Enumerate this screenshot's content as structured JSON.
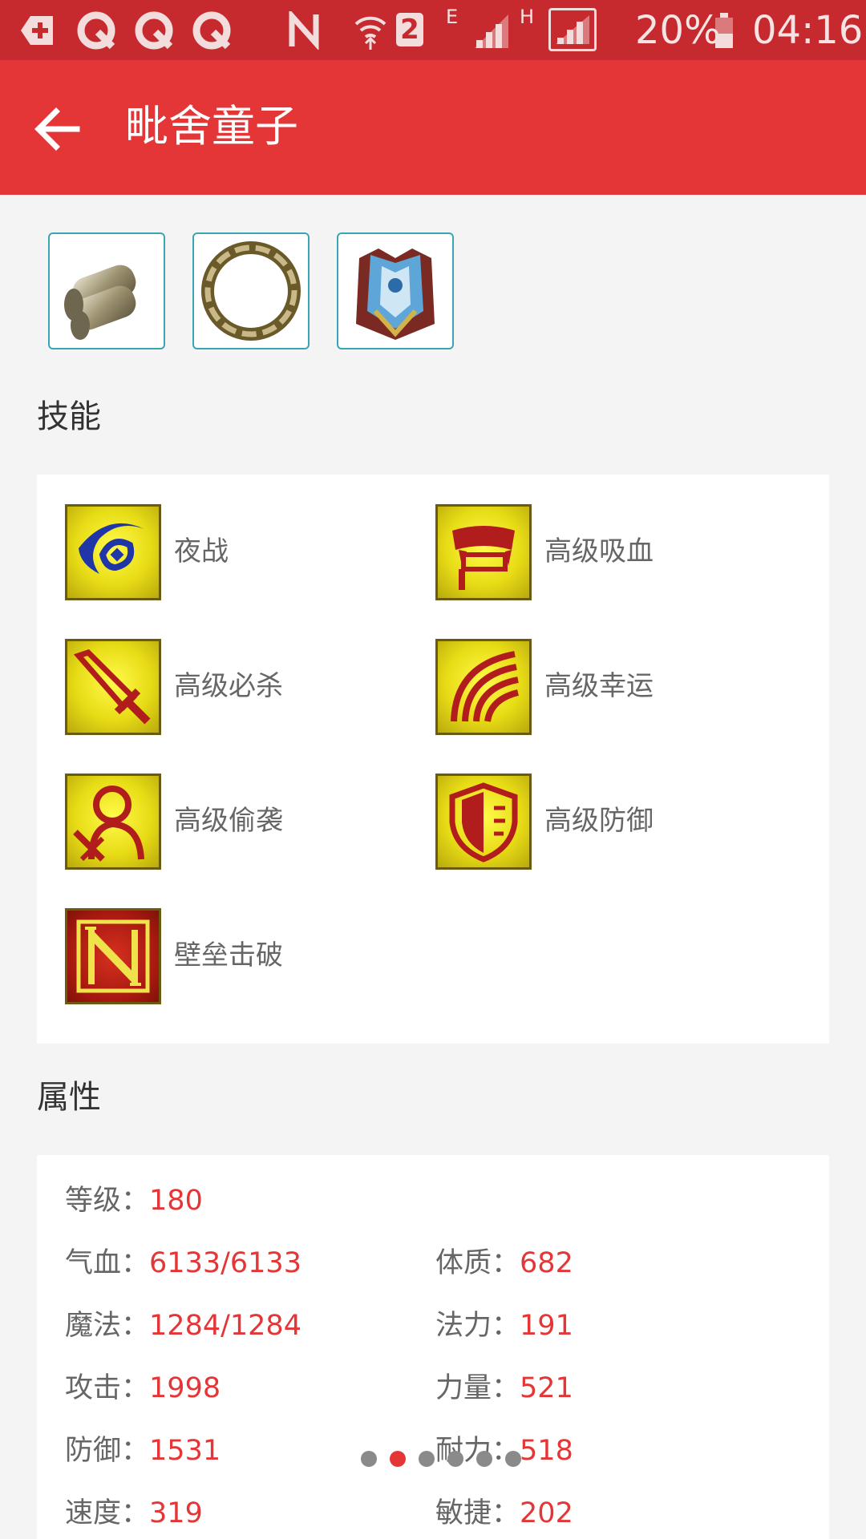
{
  "status_bar": {
    "two_badge": "2",
    "e_label": "E",
    "h_label": "H",
    "battery": "20%",
    "time": "04:16"
  },
  "app_bar": {
    "title": "毗舍童子"
  },
  "equipment": [
    {
      "name": "bracer-item-icon"
    },
    {
      "name": "ring-item-icon"
    },
    {
      "name": "armor-item-icon"
    }
  ],
  "skills_section": {
    "title": "技能",
    "items": [
      {
        "label": "夜战",
        "icon": "night-battle-icon"
      },
      {
        "label": "高级吸血",
        "icon": "vampire-icon"
      },
      {
        "label": "高级必杀",
        "icon": "sword-icon"
      },
      {
        "label": "高级幸运",
        "icon": "luck-icon"
      },
      {
        "label": "高级偷袭",
        "icon": "sneak-attack-icon"
      },
      {
        "label": "高级防御",
        "icon": "shield-icon"
      },
      {
        "label": "壁垒击破",
        "icon": "barrier-break-icon"
      }
    ]
  },
  "attributes_section": {
    "title": "属性",
    "separator": "：",
    "level": {
      "key": "等级",
      "value": "180"
    },
    "left": [
      {
        "key": "气血",
        "value": "6133/6133"
      },
      {
        "key": "魔法",
        "value": "1284/1284"
      },
      {
        "key": "攻击",
        "value": "1998"
      },
      {
        "key": "防御",
        "value": "1531"
      },
      {
        "key": "速度",
        "value": "319"
      }
    ],
    "right": [
      {
        "key": "体质",
        "value": "682"
      },
      {
        "key": "法力",
        "value": "191"
      },
      {
        "key": "力量",
        "value": "521"
      },
      {
        "key": "耐力",
        "value": "518"
      },
      {
        "key": "敏捷",
        "value": "202"
      }
    ]
  },
  "pager": {
    "count": 6,
    "active_index": 1
  },
  "colors": {
    "status_bar": "#c62a2f",
    "app_bar": "#e53637",
    "accent_value": "#e53637",
    "background": "#f4f4f4"
  }
}
